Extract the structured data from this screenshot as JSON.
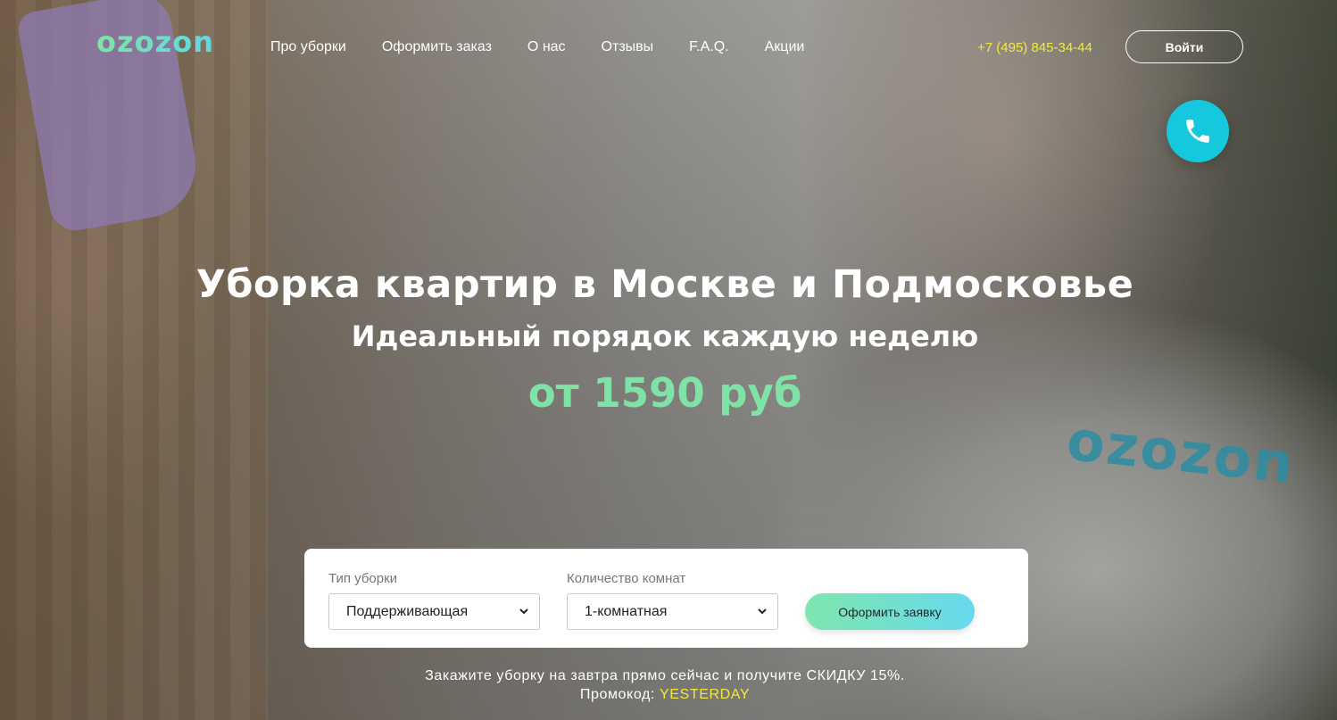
{
  "brand": {
    "logo_text": "ozozon",
    "accent": "#7fe3a6",
    "accent_secondary": "#5fd8e6"
  },
  "header": {
    "nav": [
      {
        "label": "Про уборки"
      },
      {
        "label": "Оформить заказ"
      },
      {
        "label": "О нас"
      },
      {
        "label": "Отзывы"
      },
      {
        "label": "F.A.Q."
      },
      {
        "label": "Акции"
      }
    ],
    "phone": "+7 (495) 845-34-44",
    "phone_color": "#f2ea3a",
    "login_label": "Войти",
    "call_icon": "phone-icon",
    "call_button_color": "#16c8de"
  },
  "hero": {
    "title": "Уборка квартир в Москве и Подмосковье",
    "subtitle": "Идеальный порядок каждую неделю",
    "price": "от 1590 руб",
    "shirt_logo": "ozozon"
  },
  "order_form": {
    "cleaning_type": {
      "label": "Тип уборки",
      "value": "Поддерживающая"
    },
    "rooms": {
      "label": "Количество комнат",
      "value": "1-комнатная"
    },
    "submit_label": "Оформить заявку"
  },
  "promo": {
    "line1": "Закажите уборку на завтра прямо сейчас и получите СКИДКУ 15%.",
    "code_prefix": "Промокод:",
    "code": "YESTERDAY"
  }
}
